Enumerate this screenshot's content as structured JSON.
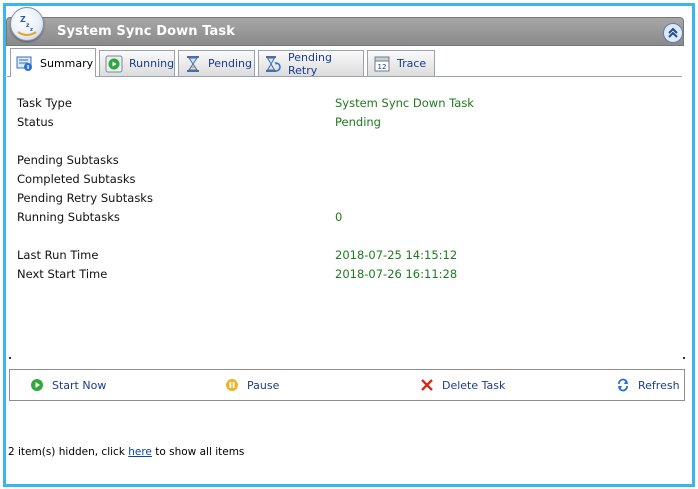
{
  "header": {
    "title": "System Sync Down Task"
  },
  "tabs": [
    {
      "label": "Summary",
      "icon": "summary-icon",
      "active": true
    },
    {
      "label": "Running",
      "icon": "play-icon",
      "active": false
    },
    {
      "label": "Pending",
      "icon": "hourglass-icon",
      "active": false
    },
    {
      "label": "Pending Retry",
      "icon": "retry-hourglass-icon",
      "active": false
    },
    {
      "label": "Trace",
      "icon": "calendar-icon",
      "active": false
    }
  ],
  "summary": {
    "task_type": {
      "label": "Task Type",
      "value": "System Sync Down Task"
    },
    "status": {
      "label": "Status",
      "value": "Pending"
    },
    "pending_subtasks": {
      "label": "Pending Subtasks",
      "value": ""
    },
    "completed_subtasks": {
      "label": "Completed Subtasks",
      "value": ""
    },
    "pending_retry_subtasks": {
      "label": "Pending Retry Subtasks",
      "value": ""
    },
    "running_subtasks": {
      "label": "Running Subtasks",
      "value": "0"
    },
    "last_run_time": {
      "label": "Last Run Time",
      "value": "2018-07-25 14:15:12"
    },
    "next_start_time": {
      "label": "Next Start Time",
      "value": "2018-07-26 16:11:28"
    }
  },
  "actions": {
    "start_now": "Start Now",
    "pause": "Pause",
    "delete_task": "Delete Task",
    "refresh": "Refresh"
  },
  "footer": {
    "prefix": "2 item(s) hidden, click ",
    "link": "here",
    "suffix": " to show all items"
  },
  "colors": {
    "frame_border": "#38b7ef",
    "header_bg": "#9a9a9a",
    "value_text": "#1e7a1e",
    "link_text": "#1a3c8f",
    "hyperlink": "#0645ad"
  }
}
